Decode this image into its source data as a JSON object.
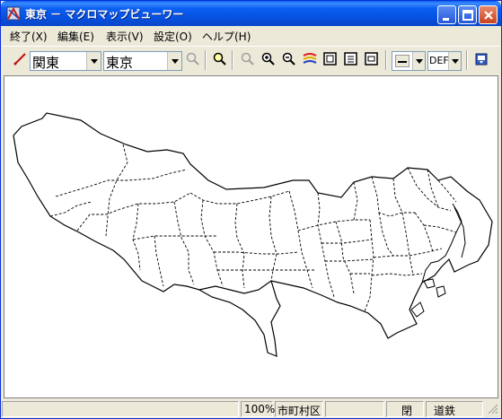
{
  "window": {
    "title": "東京 － マクロマップビューワー"
  },
  "menu": {
    "items": [
      "終了(X)",
      "編集(E)",
      "表示(V)",
      "設定(O)",
      "ヘルプ(H)"
    ]
  },
  "toolbar": {
    "region_value": "関東",
    "prefecture_value": "東京",
    "style_value": "DEF"
  },
  "status": {
    "zoom": "100%",
    "layer": "市町村区",
    "panel3": "",
    "panel4": "閉",
    "panel5": "道鉄"
  },
  "icons": {
    "app": "map-app-icon",
    "minimize": "minimize-icon",
    "maximize": "maximize-icon",
    "close": "close-icon"
  }
}
